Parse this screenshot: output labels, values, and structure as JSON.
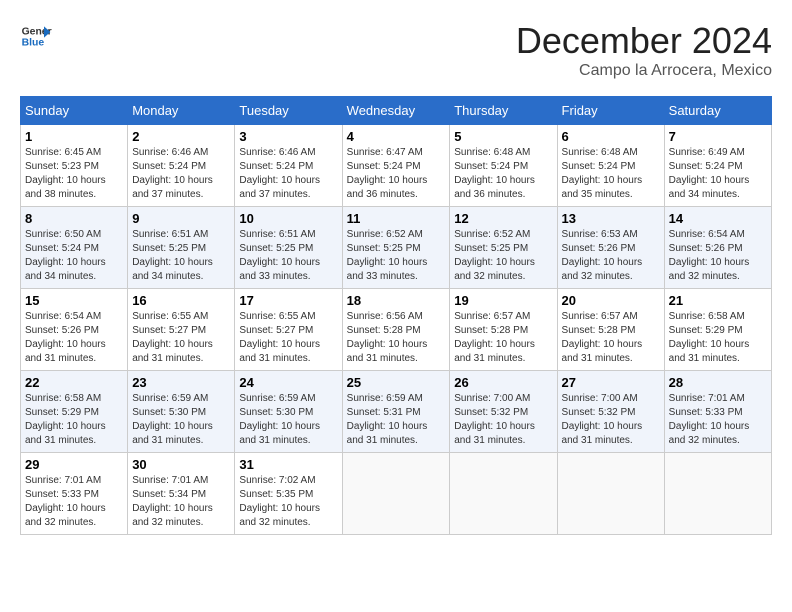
{
  "header": {
    "logo_general": "General",
    "logo_blue": "Blue",
    "month_title": "December 2024",
    "location": "Campo la Arrocera, Mexico"
  },
  "weekdays": [
    "Sunday",
    "Monday",
    "Tuesday",
    "Wednesday",
    "Thursday",
    "Friday",
    "Saturday"
  ],
  "weeks": [
    [
      {
        "day": "1",
        "sunrise": "6:45 AM",
        "sunset": "5:23 PM",
        "daylight": "10 hours and 38 minutes."
      },
      {
        "day": "2",
        "sunrise": "6:46 AM",
        "sunset": "5:24 PM",
        "daylight": "10 hours and 37 minutes."
      },
      {
        "day": "3",
        "sunrise": "6:46 AM",
        "sunset": "5:24 PM",
        "daylight": "10 hours and 37 minutes."
      },
      {
        "day": "4",
        "sunrise": "6:47 AM",
        "sunset": "5:24 PM",
        "daylight": "10 hours and 36 minutes."
      },
      {
        "day": "5",
        "sunrise": "6:48 AM",
        "sunset": "5:24 PM",
        "daylight": "10 hours and 36 minutes."
      },
      {
        "day": "6",
        "sunrise": "6:48 AM",
        "sunset": "5:24 PM",
        "daylight": "10 hours and 35 minutes."
      },
      {
        "day": "7",
        "sunrise": "6:49 AM",
        "sunset": "5:24 PM",
        "daylight": "10 hours and 34 minutes."
      }
    ],
    [
      {
        "day": "8",
        "sunrise": "6:50 AM",
        "sunset": "5:24 PM",
        "daylight": "10 hours and 34 minutes."
      },
      {
        "day": "9",
        "sunrise": "6:51 AM",
        "sunset": "5:25 PM",
        "daylight": "10 hours and 34 minutes."
      },
      {
        "day": "10",
        "sunrise": "6:51 AM",
        "sunset": "5:25 PM",
        "daylight": "10 hours and 33 minutes."
      },
      {
        "day": "11",
        "sunrise": "6:52 AM",
        "sunset": "5:25 PM",
        "daylight": "10 hours and 33 minutes."
      },
      {
        "day": "12",
        "sunrise": "6:52 AM",
        "sunset": "5:25 PM",
        "daylight": "10 hours and 32 minutes."
      },
      {
        "day": "13",
        "sunrise": "6:53 AM",
        "sunset": "5:26 PM",
        "daylight": "10 hours and 32 minutes."
      },
      {
        "day": "14",
        "sunrise": "6:54 AM",
        "sunset": "5:26 PM",
        "daylight": "10 hours and 32 minutes."
      }
    ],
    [
      {
        "day": "15",
        "sunrise": "6:54 AM",
        "sunset": "5:26 PM",
        "daylight": "10 hours and 31 minutes."
      },
      {
        "day": "16",
        "sunrise": "6:55 AM",
        "sunset": "5:27 PM",
        "daylight": "10 hours and 31 minutes."
      },
      {
        "day": "17",
        "sunrise": "6:55 AM",
        "sunset": "5:27 PM",
        "daylight": "10 hours and 31 minutes."
      },
      {
        "day": "18",
        "sunrise": "6:56 AM",
        "sunset": "5:28 PM",
        "daylight": "10 hours and 31 minutes."
      },
      {
        "day": "19",
        "sunrise": "6:57 AM",
        "sunset": "5:28 PM",
        "daylight": "10 hours and 31 minutes."
      },
      {
        "day": "20",
        "sunrise": "6:57 AM",
        "sunset": "5:28 PM",
        "daylight": "10 hours and 31 minutes."
      },
      {
        "day": "21",
        "sunrise": "6:58 AM",
        "sunset": "5:29 PM",
        "daylight": "10 hours and 31 minutes."
      }
    ],
    [
      {
        "day": "22",
        "sunrise": "6:58 AM",
        "sunset": "5:29 PM",
        "daylight": "10 hours and 31 minutes."
      },
      {
        "day": "23",
        "sunrise": "6:59 AM",
        "sunset": "5:30 PM",
        "daylight": "10 hours and 31 minutes."
      },
      {
        "day": "24",
        "sunrise": "6:59 AM",
        "sunset": "5:30 PM",
        "daylight": "10 hours and 31 minutes."
      },
      {
        "day": "25",
        "sunrise": "6:59 AM",
        "sunset": "5:31 PM",
        "daylight": "10 hours and 31 minutes."
      },
      {
        "day": "26",
        "sunrise": "7:00 AM",
        "sunset": "5:32 PM",
        "daylight": "10 hours and 31 minutes."
      },
      {
        "day": "27",
        "sunrise": "7:00 AM",
        "sunset": "5:32 PM",
        "daylight": "10 hours and 31 minutes."
      },
      {
        "day": "28",
        "sunrise": "7:01 AM",
        "sunset": "5:33 PM",
        "daylight": "10 hours and 32 minutes."
      }
    ],
    [
      {
        "day": "29",
        "sunrise": "7:01 AM",
        "sunset": "5:33 PM",
        "daylight": "10 hours and 32 minutes."
      },
      {
        "day": "30",
        "sunrise": "7:01 AM",
        "sunset": "5:34 PM",
        "daylight": "10 hours and 32 minutes."
      },
      {
        "day": "31",
        "sunrise": "7:02 AM",
        "sunset": "5:35 PM",
        "daylight": "10 hours and 32 minutes."
      },
      null,
      null,
      null,
      null
    ]
  ]
}
